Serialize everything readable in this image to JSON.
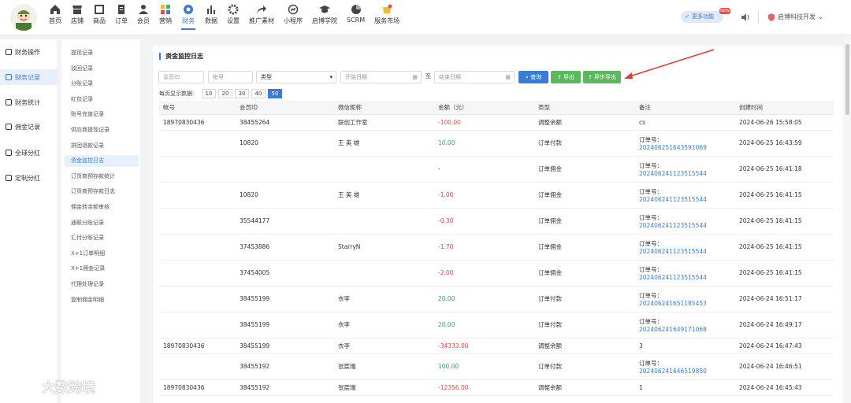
{
  "nav": {
    "items": [
      {
        "label": "首页",
        "icon": "home-icon"
      },
      {
        "label": "店铺",
        "icon": "store-icon"
      },
      {
        "label": "商品",
        "icon": "goods-icon"
      },
      {
        "label": "订单",
        "icon": "order-icon"
      },
      {
        "label": "会员",
        "icon": "member-icon"
      },
      {
        "label": "营销",
        "icon": "marketing-icon"
      },
      {
        "label": "财务",
        "icon": "finance-icon",
        "active": true
      },
      {
        "label": "数据",
        "icon": "data-icon"
      },
      {
        "label": "设置",
        "icon": "settings-icon"
      },
      {
        "label": "推广素材",
        "icon": "share-icon"
      },
      {
        "label": "小程序",
        "icon": "miniprogram-icon"
      },
      {
        "label": "启博学院",
        "icon": "academy-icon"
      },
      {
        "label": "SCRM",
        "icon": "scrm-icon"
      },
      {
        "label": "服务市场",
        "icon": "market-icon"
      }
    ],
    "more_label": "更多功能",
    "new_badge": "NEW",
    "company": "启博科技开发"
  },
  "sidebar1": {
    "items": [
      {
        "label": "财务操作",
        "icon": "finance-op-icon"
      },
      {
        "label": "财务记录",
        "icon": "finance-record-icon",
        "active": true
      },
      {
        "label": "财务统计",
        "icon": "finance-stat-icon"
      },
      {
        "label": "佣金记录",
        "icon": "commission-icon"
      },
      {
        "label": "全球分红",
        "icon": "global-dividend-icon"
      },
      {
        "label": "定制分红",
        "icon": "custom-dividend-icon"
      }
    ]
  },
  "sidebar2": {
    "items": [
      "提现记录",
      "驳回记录",
      "分账记录",
      "红包记录",
      "账号充值记录",
      "供应商提现记录",
      "拼团退款记录",
      "资金监控日志",
      "订货商预存款统计",
      "订货商预存款日志",
      "佣金转余额审核",
      "通联分账记录",
      "汇付分账记录",
      "X+1订单明细",
      "X+1佣金记录",
      "代理处理记录",
      "复制佣金明细"
    ],
    "active_index": 7
  },
  "main": {
    "title": "资金监控日志",
    "filters": {
      "member_id": "会员ID",
      "account": "帐号",
      "type": "类型",
      "start_date": "开始日期",
      "to": "至",
      "end_date": "结束日期"
    },
    "buttons": {
      "search": "查询",
      "export": "导出",
      "async_export": "异步导出"
    },
    "page_size_label": "每页显示数据:",
    "page_sizes": [
      "10",
      "20",
      "30",
      "40",
      "50"
    ],
    "active_page_size": "50",
    "columns": [
      "帐号",
      "会员ID",
      "微信昵称",
      "金额（元）",
      "类型",
      "备注",
      "创建时间"
    ],
    "rows": [
      {
        "account": "18970830436",
        "member_id": "38455264",
        "nickname": "联创工作室",
        "amount": "-100.00",
        "sign": "neg",
        "type": "调整余额",
        "note_label": "cs",
        "order_no": "",
        "time": "2024-06-26 15:58:05"
      },
      {
        "account": "",
        "member_id": "10820",
        "nickname": "王 英 雄",
        "amount": "10.00",
        "sign": "pos",
        "type": "订单付款",
        "note_label": "订单号：",
        "order_no": "202406251643591069",
        "time": "2024-06-25 16:43:59"
      },
      {
        "account": "",
        "member_id": "",
        "nickname": "",
        "amount": "-",
        "sign": "none",
        "type": "订单佣金",
        "note_label": "订单号：",
        "order_no": "202406241123515544",
        "time": "2024-06-25 16:41:18"
      },
      {
        "account": "",
        "member_id": "10820",
        "nickname": "王 英 雄",
        "amount": "-1.00",
        "sign": "neg",
        "type": "订单佣金",
        "note_label": "订单号：",
        "order_no": "202406241123515544",
        "time": "2024-06-25 16:41:15"
      },
      {
        "account": "",
        "member_id": "35544177",
        "nickname": "",
        "amount": "-0.30",
        "sign": "neg",
        "type": "订单佣金",
        "note_label": "订单号：",
        "order_no": "202406241123515544",
        "time": "2024-06-25 16:41:15"
      },
      {
        "account": "",
        "member_id": "37453886",
        "nickname": "StarryN",
        "amount": "-1.70",
        "sign": "neg",
        "type": "订单佣金",
        "note_label": "订单号：",
        "order_no": "202406241123515544",
        "time": "2024-06-25 16:41:15"
      },
      {
        "account": "",
        "member_id": "37454005",
        "nickname": "",
        "amount": "-2.00",
        "sign": "neg",
        "type": "订单佣金",
        "note_label": "订单号：",
        "order_no": "202406241123515544",
        "time": "2024-06-25 16:41:15"
      },
      {
        "account": "",
        "member_id": "38455199",
        "nickname": "衣李",
        "amount": "20.00",
        "sign": "pos",
        "type": "订单付款",
        "note_label": "订单号：",
        "order_no": "202406241651185453",
        "time": "2024-06-24 16:51:17"
      },
      {
        "account": "",
        "member_id": "38455199",
        "nickname": "衣李",
        "amount": "20.00",
        "sign": "pos",
        "type": "订单付款",
        "note_label": "订单号：",
        "order_no": "202406241649171068",
        "time": "2024-06-24 16:49:17"
      },
      {
        "account": "18970830436",
        "member_id": "38455199",
        "nickname": "衣李",
        "amount": "-34333.00",
        "sign": "neg",
        "type": "调整余额",
        "note_label": "3",
        "order_no": "",
        "time": "2024-06-24 16:47:43"
      },
      {
        "account": "",
        "member_id": "38455192",
        "nickname": "张宸瑞",
        "amount": "100.00",
        "sign": "pos",
        "type": "订单付款",
        "note_label": "订单号：",
        "order_no": "202406241646519850",
        "time": "2024-06-24 16:46:51"
      },
      {
        "account": "18970830436",
        "member_id": "38455192",
        "nickname": "张宸瑞",
        "amount": "-12356.00",
        "sign": "neg",
        "type": "调整余额",
        "note_label": "1",
        "order_no": "",
        "time": "2024-06-24 16:45:43"
      }
    ]
  },
  "watermark": "大数跨境"
}
